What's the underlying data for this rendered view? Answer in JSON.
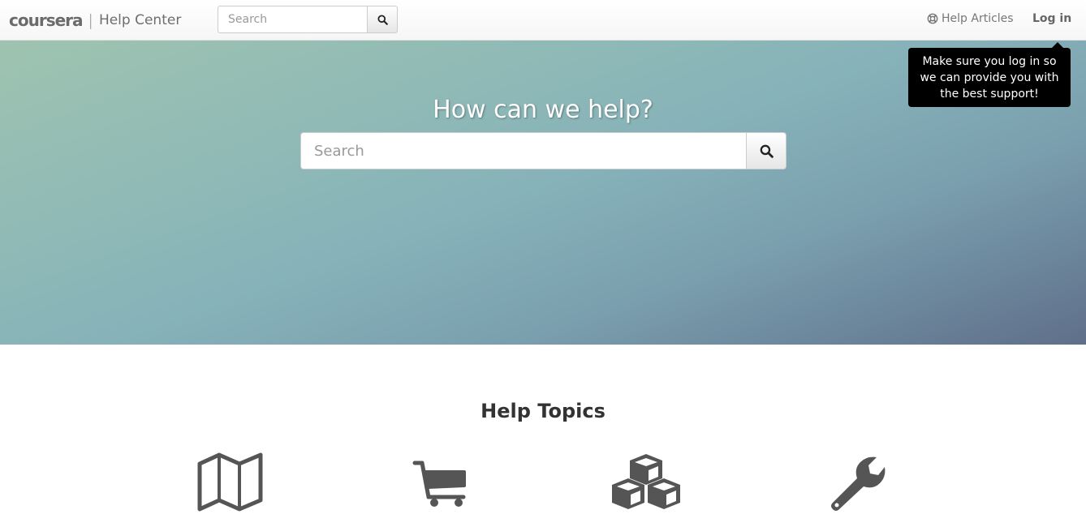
{
  "header": {
    "logo_text": "coursera",
    "separator": "|",
    "subtitle": "Help Center",
    "search_placeholder": "Search",
    "search_icon": "search-icon",
    "help_articles_label": "Help Articles",
    "help_articles_icon": "life-ring-icon",
    "login_label": "Log in"
  },
  "tooltip": {
    "text": "Make sure you log in so we can provide you with the best support!"
  },
  "hero": {
    "title": "How can we help?",
    "search_placeholder": "Search",
    "search_icon": "search-icon"
  },
  "topics": {
    "title": "Help Topics",
    "items": [
      {
        "icon": "map-icon"
      },
      {
        "icon": "shopping-cart-icon"
      },
      {
        "icon": "cubes-icon"
      },
      {
        "icon": "wrench-icon"
      }
    ]
  },
  "colors": {
    "icon_gray": "#555555",
    "tooltip_bg": "#000000"
  }
}
